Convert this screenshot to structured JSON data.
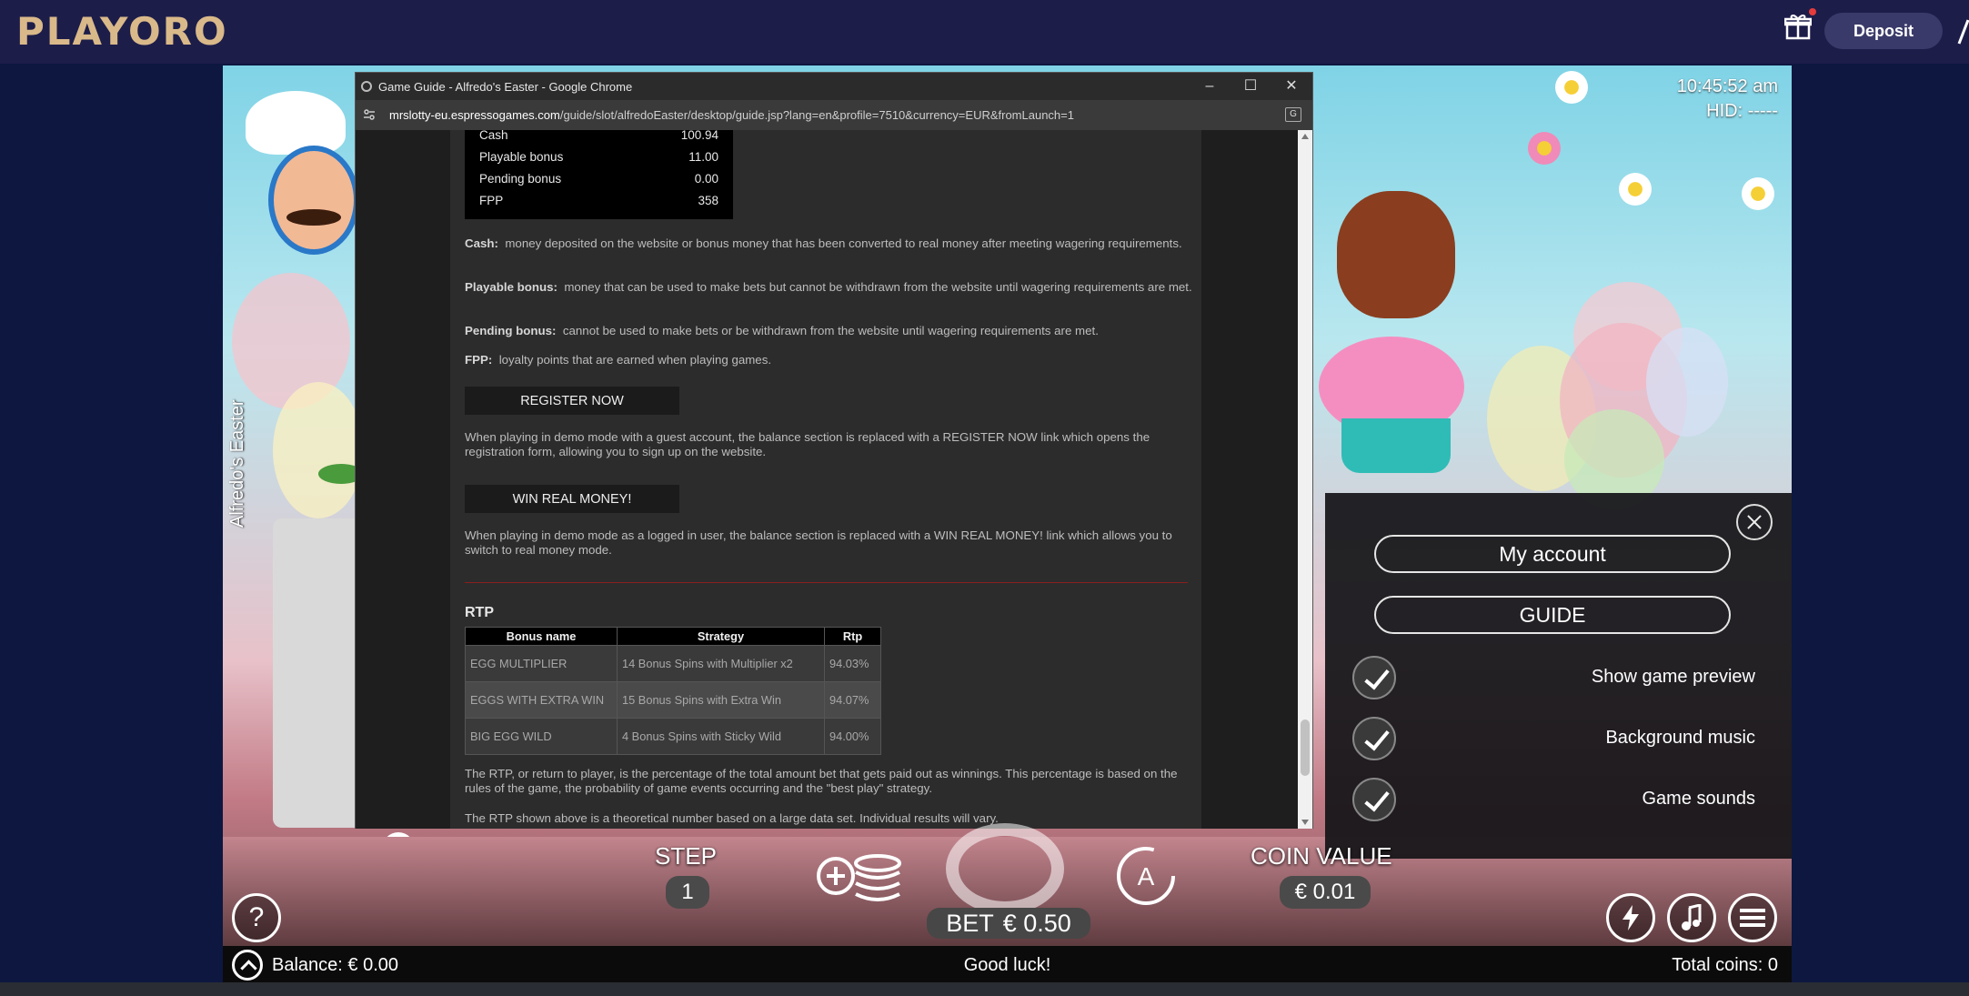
{
  "site": {
    "logo": "PLAYORO",
    "deposit_label": "Deposit",
    "gift_icon": "gift-icon"
  },
  "game": {
    "vertical_title": "Alfredo's Easter",
    "clock": "10:45:52 am",
    "hid": "HID: -----"
  },
  "chrome": {
    "window_title": "Game Guide - Alfredo's Easter - Google Chrome",
    "url_host": "mrslotty-eu.espressogames.com",
    "url_path": "/guide/slot/alfredoEaster/desktop/guide.jsp?lang=en&profile=7510&currency=EUR&fromLaunch=1",
    "minimize": "–",
    "maximize": "☐",
    "close": "✕"
  },
  "guide": {
    "balance_rows": [
      {
        "label": "Cash",
        "value": "100.94"
      },
      {
        "label": "Playable bonus",
        "value": "11.00"
      },
      {
        "label": "Pending bonus",
        "value": "0.00"
      },
      {
        "label": "FPP",
        "value": "358"
      }
    ],
    "cash_term": "Cash:",
    "cash_text": "money deposited on the website or bonus money that has been converted to real money after meeting wagering requirements.",
    "playable_term": "Playable bonus:",
    "playable_text": "money that can be used to make bets but cannot be withdrawn from the website until wagering requirements are met.",
    "pending_term": "Pending bonus:",
    "pending_text": "cannot be used to make bets or be withdrawn from the website until wagering requirements are met.",
    "fpp_term": "FPP:",
    "fpp_text": "loyalty points that are earned when playing games.",
    "register_btn": "REGISTER NOW",
    "register_text": "When playing in demo mode with a guest account, the balance section is replaced with a REGISTER NOW link which opens the registration form, allowing you to sign up on the website.",
    "winreal_btn": "WIN REAL MONEY!",
    "winreal_text": "When playing in demo mode as a logged in user, the balance section is replaced with a WIN REAL MONEY! link which allows you to switch to real money mode.",
    "rtp_heading": "RTP",
    "rtp_table": {
      "headers": [
        "Bonus name",
        "Strategy",
        "Rtp"
      ],
      "rows": [
        [
          "EGG MULTIPLIER",
          "14 Bonus Spins with Multiplier x2",
          "94.03%"
        ],
        [
          "EGGS WITH EXTRA WIN",
          "15 Bonus Spins with Extra Win",
          "94.07%"
        ],
        [
          "BIG EGG WILD",
          "4 Bonus Spins with Sticky Wild",
          "94.00%"
        ]
      ]
    },
    "rtp_text_1": "The RTP, or return to player, is the percentage of the total amount bet that gets paid out as winnings. This percentage is based on the rules of the game, the probability of game events occurring and the \"best play\" strategy.",
    "rtp_text_2": "The RTP shown above is a theoretical number based on a large data set. Individual results will vary."
  },
  "menu": {
    "my_account": "My account",
    "guide": "GUIDE",
    "options": [
      {
        "label": "Show game preview",
        "checked": true
      },
      {
        "label": "Background music",
        "checked": true
      },
      {
        "label": "Game sounds",
        "checked": true
      }
    ]
  },
  "controls": {
    "step_label": "STEP",
    "step_value": "1",
    "coin_value_label": "COIN VALUE",
    "coin_value": "€ 0.01",
    "bet_label": "BET",
    "bet_value": "€ 0.50",
    "help": "?"
  },
  "status": {
    "balance": "Balance: € 0.00",
    "message": "Good luck!",
    "total_coins": "Total coins: 0"
  }
}
